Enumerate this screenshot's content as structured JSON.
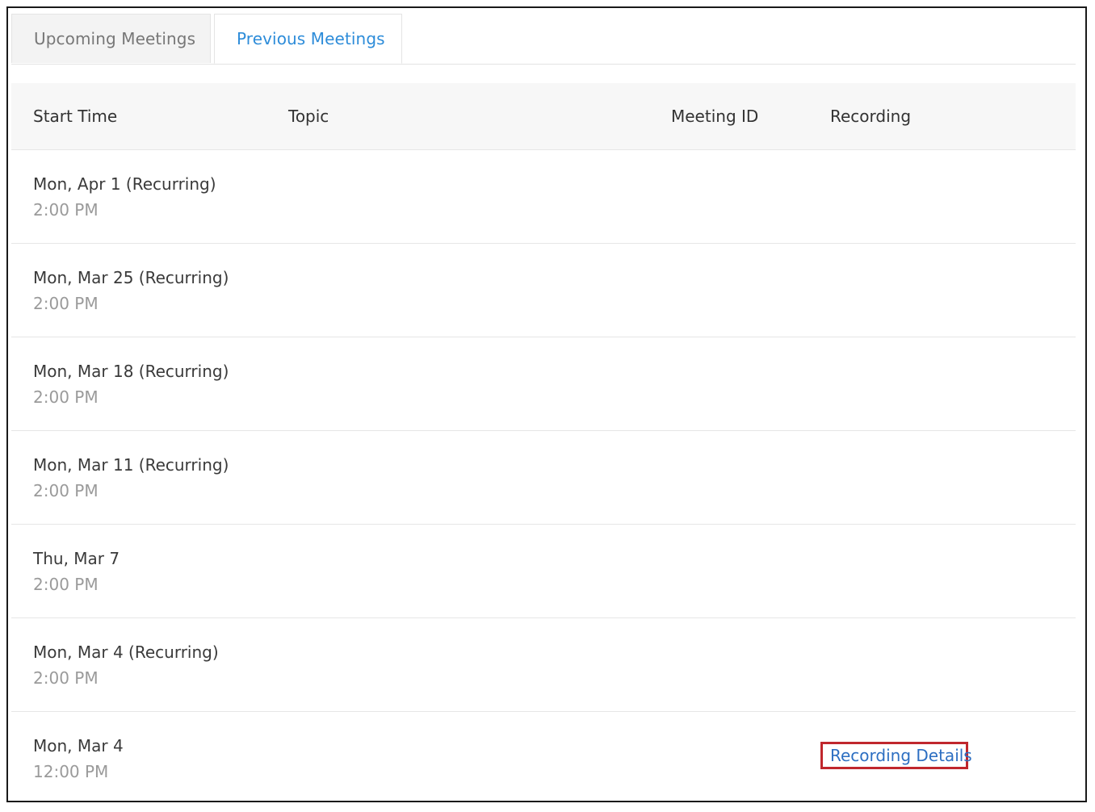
{
  "tabs": [
    {
      "label": "Upcoming Meetings",
      "active": false
    },
    {
      "label": "Previous Meetings",
      "active": true
    }
  ],
  "table": {
    "columns": [
      "Start Time",
      "Topic",
      "Meeting ID",
      "Recording"
    ],
    "rows": [
      {
        "date": "Mon, Apr 1 (Recurring)",
        "time": "2:00 PM",
        "recording": ""
      },
      {
        "date": "Mon, Mar 25 (Recurring)",
        "time": "2:00 PM",
        "recording": ""
      },
      {
        "date": "Mon, Mar 18 (Recurring)",
        "time": "2:00 PM",
        "recording": ""
      },
      {
        "date": "Mon, Mar 11 (Recurring)",
        "time": "2:00 PM",
        "recording": ""
      },
      {
        "date": "Thu, Mar 7",
        "time": "2:00 PM",
        "recording": ""
      },
      {
        "date": "Mon, Mar 4 (Recurring)",
        "time": "2:00 PM",
        "recording": ""
      },
      {
        "date": "Mon, Mar 4",
        "time": "12:00 PM",
        "recording": "Recording Details"
      }
    ]
  },
  "colors": {
    "active_tab": "#2d8cd9",
    "link": "#2d6fc2",
    "highlight_box": "#c0272d"
  }
}
